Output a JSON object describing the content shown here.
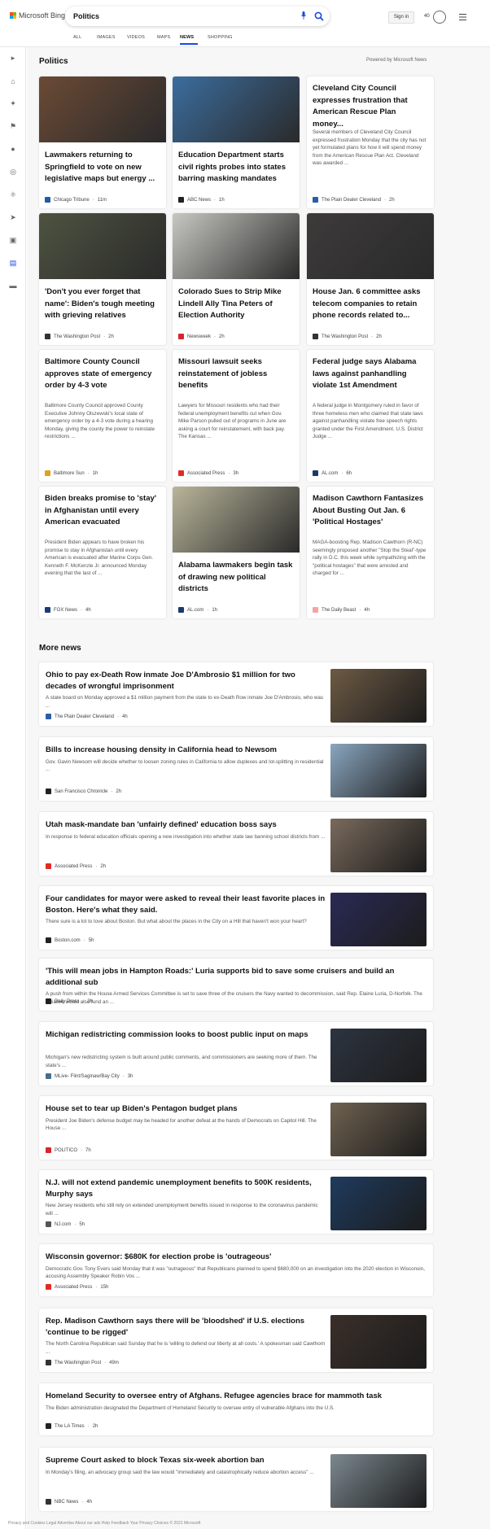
{
  "header": {
    "logo_text": "Microsoft Bing",
    "search_value": "Politics",
    "signin_label": "Sign in",
    "reward_count": "40",
    "tabs": [
      "ALL",
      "IMAGES",
      "VIDEOS",
      "MAPS",
      "NEWS",
      "SHOPPING"
    ],
    "active_tab": "NEWS"
  },
  "sidebar": {
    "icons": [
      "expand-icon",
      "home-icon",
      "sports-icon",
      "flag-icon",
      "location-icon",
      "globe-icon",
      "science-icon",
      "rocket-icon",
      "entertainment-icon",
      "politics-icon",
      "money-icon"
    ]
  },
  "politics": {
    "title": "Politics",
    "powered": "Powered by Microsoft News",
    "cards": [
      {
        "title": "Lawmakers returning to Springfield to vote on new legislative maps but energy ...",
        "desc": "",
        "source": "Chicago Tribune",
        "time": "11m",
        "fav_color": "#1f5ba8",
        "img": "#6b4a35"
      },
      {
        "title": "Education Department starts civil rights probes into states barring masking mandates",
        "desc": "",
        "source": "ABC News",
        "time": "1h",
        "fav_color": "#222222",
        "img": "#3b6d9e"
      },
      {
        "title": "Cleveland City Council expresses frustration that American Rescue Plan money...",
        "desc": "Several members of Cleveland City Council expressed frustration Monday that the city has not yet formulated plans for how it will spend money from the American Rescue Plan Act. Cleveland was awarded ...",
        "source": "The Plain Dealer Cleveland",
        "time": "2h",
        "fav_color": "#2b5ea7",
        "img": ""
      },
      {
        "title": "'Don't you ever forget that name': Biden's tough meeting with grieving relatives",
        "desc": "",
        "source": "The Washington Post",
        "time": "2h",
        "fav_color": "#333333",
        "img": "#4e5340"
      },
      {
        "title": "Colorado Sues to Strip Mike Lindell Ally Tina Peters of Election Authority",
        "desc": "",
        "source": "Newsweek",
        "time": "2h",
        "fav_color": "#d9242b",
        "img": "#c7c8c2"
      },
      {
        "title": "House Jan. 6 committee asks telecom companies to retain phone records related to...",
        "desc": "",
        "source": "The Washington Post",
        "time": "2h",
        "fav_color": "#333333",
        "img": "#3d3a3a"
      },
      {
        "title": "Baltimore County Council approves state of emergency order by 4-3 vote",
        "desc": "Baltimore County Council approved County Executive Johnny Olszewski's local state of emergency order by a 4-3 vote during a hearing Monday, giving the county the power to reinstate restrictions ...",
        "source": "Baltimore Sun",
        "time": "1h",
        "fav_color": "#e0a11b",
        "img": ""
      },
      {
        "title": "Missouri lawsuit seeks reinstatement of jobless benefits",
        "desc": "Lawyers for Missouri residents who had their federal unemployment benefits cut when Gov. Mike Parson pulled out of programs in June are asking a court for reinstatement, with back pay. The Kansas ...",
        "source": "Associated Press",
        "time": "3h",
        "fav_color": "#e32a24",
        "img": ""
      },
      {
        "title": "Federal judge says Alabama laws against panhandling violate 1st Amendment",
        "desc": "A federal judge in Montgomery ruled in favor of three homeless men who claimed that state laws against panhandling violate free speech rights granted under the First Amendment. U.S. District Judge ...",
        "source": "AL.com",
        "time": "6h",
        "fav_color": "#1a3a6b",
        "img": ""
      },
      {
        "title": "Biden breaks promise to 'stay' in Afghanistan until every American evacuated",
        "desc": "President Biden appears to have broken his promise to stay in Afghanistan until every American is evacuated after Marine Corps Gen. Kenneth F. McKenzie Jr. announced Monday evening that the last of ...",
        "source": "FOX News",
        "time": "4h",
        "fav_color": "#1b3a7a",
        "img": ""
      },
      {
        "title": "Alabama lawmakers begin task of drawing new political districts",
        "desc": "",
        "source": "AL.com",
        "time": "1h",
        "fav_color": "#1a3a6b",
        "img": "#b9b59a"
      },
      {
        "title": "Madison Cawthorn Fantasizes About Busting Out Jan. 6 'Political Hostages'",
        "desc": "MAGA-boosting Rep. Madison Cawthorn (R-NC) seemingly proposed another \"Stop the Steal\"-type rally in D.C. this week while sympathizing with the \"political hostages\" that were arrested and charged for ...",
        "source": "The Daily Beast",
        "time": "4h",
        "fav_color": "#f5a3a3",
        "img": ""
      }
    ]
  },
  "more_news": {
    "title": "More news",
    "items": [
      {
        "title": "Ohio to pay ex-Death Row inmate Joe D'Ambrosio $1 million for two decades of wrongful imprisonment",
        "desc": "A state board on Monday approved a $1 million payment from the state to ex-Death Row inmate Joe D'Ambrosio, who was ...",
        "source": "The Plain Dealer Cleveland",
        "time": "4h",
        "fav_color": "#2b5ea7",
        "img": "#6d5a44"
      },
      {
        "title": "Bills to increase housing density in California head to Newsom",
        "desc": "Gov. Gavin Newsom will decide whether to loosen zoning rules in California to allow duplexes and lot-splitting in residential ...",
        "source": "San Francisco Chronicle",
        "time": "2h",
        "fav_color": "#222222",
        "img": "#8aa6bf"
      },
      {
        "title": "Utah mask-mandate ban 'unfairly defined' education boss says",
        "desc": "In response to federal education officials opening a new investigation into whether state law banning school districts from ...",
        "source": "Associated Press",
        "time": "2h",
        "fav_color": "#e32a24",
        "img": "#7a6a5c"
      },
      {
        "title": "Four candidates for mayor were asked to reveal their least favorite places in Boston. Here's what they said.",
        "desc": "There sure is a lot to love about Boston. But what about the places in the City on a Hill that haven't won your heart?",
        "source": "Boston.com",
        "time": "5h",
        "fav_color": "#222222",
        "img": "#2a2a55"
      },
      {
        "title": "'This will mean jobs in Hampton Roads:' Luria supports bid to save some cruisers and build an additional sub",
        "desc": "A push from within the House Armed Services Committee is set to save three of the cruisers the Navy wanted to decommission, said Rep. Elaine Luria, D-Norfolk. The initiative would also fund an ...",
        "source": "Daily Press",
        "time": "3h",
        "fav_color": "#222222",
        "img": ""
      },
      {
        "title": "Michigan redistricting commission looks to boost public input on maps",
        "desc": "Michigan's new redistricting system is built around public comments, and commissioners are seeking more of them. The state's ...",
        "source": "MLive- Flint/Saginaw/Bay City",
        "time": "3h",
        "fav_color": "#4a6d8c",
        "img": "#2d3440"
      },
      {
        "title": "House set to tear up Biden's Pentagon budget plans",
        "desc": "President Joe Biden's defense budget may be headed for another defeat at the hands of Democrats on Capitol Hill. The House ...",
        "source": "POLITICO",
        "time": "7h",
        "fav_color": "#d9242b",
        "img": "#6f6250"
      },
      {
        "title": "N.J. will not extend pandemic unemployment benefits to 500K residents, Murphy says",
        "desc": "New Jersey residents who still rely on extended unemployment benefits issued in response to the coronavirus pandemic will ...",
        "source": "NJ.com",
        "time": "5h",
        "fav_color": "#555555",
        "img": "#1e3b5e"
      },
      {
        "title": "Wisconsin governor: $680K for election probe is 'outrageous'",
        "desc": "Democratic Gov. Tony Evers said Monday that it was \"outrageous\" that Republicans planned to spend $680,000 on an investigation into the 2020 election in Wisconsin, accusing Assembly Speaker Robin Vos ...",
        "source": "Associated Press",
        "time": "15h",
        "fav_color": "#e32a24",
        "img": ""
      },
      {
        "title": "Rep. Madison Cawthorn says there will be 'bloodshed' if U.S. elections 'continue to be rigged'",
        "desc": "The North Carolina Republican said Sunday that he is 'willing to defend our liberty at all costs.' A spokesman said Cawthorn ...",
        "source": "The Washington Post",
        "time": "49m",
        "fav_color": "#333333",
        "img": "#3a2f2a"
      },
      {
        "title": "Homeland Security to oversee entry of Afghans. Refugee agencies brace for mammoth task",
        "desc": "The Biden administration designated the Department of Homeland Security to oversee entry of vulnerable Afghans into the U.S.",
        "source": "The LA Times",
        "time": "2h",
        "fav_color": "#222222",
        "img": ""
      },
      {
        "title": "Supreme Court asked to block Texas six-week abortion ban",
        "desc": "In Monday's filing, an advocacy group said the law would \"immediately and catastrophically reduce abortion access\" ...",
        "source": "NBC News",
        "time": "4h",
        "fav_color": "#333333",
        "img": "#7c8890"
      }
    ]
  },
  "footer": {
    "text": "Privacy and Cookies  Legal  Advertise  About our ads  Help  Feedback  Your Privacy Choices  © 2021 Microsoft"
  }
}
